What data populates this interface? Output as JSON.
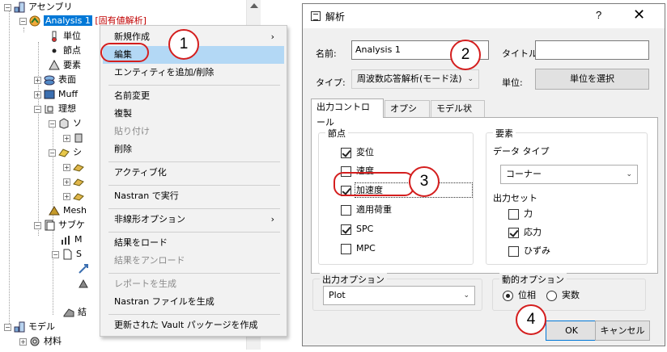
{
  "tree": {
    "items": [
      {
        "label": "アセンブリ",
        "icon": "assembly-icon"
      },
      {
        "label": "Analysis 1",
        "suffix": "[固有値解析]",
        "icon": "analysis-icon"
      },
      {
        "label": "単位",
        "icon": "thermometer-icon"
      },
      {
        "label": "節点",
        "icon": "node-icon"
      },
      {
        "label": "要素",
        "icon": "element-icon"
      },
      {
        "label": "表面",
        "icon": "surface-icon"
      },
      {
        "label": "Muff",
        "icon": "mesh-part-icon"
      },
      {
        "label": "理想",
        "icon": "idealization-icon"
      },
      {
        "label": "ソ",
        "icon": "solid-icon"
      },
      {
        "label": "シ",
        "icon": "shell-icon"
      },
      {
        "label": "Mesh",
        "icon": "mesh-icon"
      },
      {
        "label": "サブケ",
        "icon": "subcase-icon"
      },
      {
        "label": "M",
        "icon": "bar-chart-icon"
      },
      {
        "label": "S",
        "icon": "document-icon"
      },
      {
        "label": "結",
        "icon": "result-icon"
      },
      {
        "label": "モデル",
        "icon": "model-icon"
      },
      {
        "label": "材料",
        "icon": "material-icon"
      }
    ]
  },
  "context_menu": {
    "items": [
      {
        "label": "新規作成",
        "submenu": true
      },
      {
        "label": "編集",
        "highlighted": true
      },
      {
        "label": "エンティティを追加/削除"
      },
      {
        "label": "名前変更"
      },
      {
        "label": "複製"
      },
      {
        "label": "貼り付け",
        "disabled": true
      },
      {
        "label": "削除"
      },
      {
        "label": "アクティブ化"
      },
      {
        "label": "Nastran で実行"
      },
      {
        "label": "非線形オプション",
        "submenu": true
      },
      {
        "label": "結果をロード"
      },
      {
        "label": "結果をアンロード",
        "disabled": true
      },
      {
        "label": "レポートを生成",
        "disabled": true
      },
      {
        "label": "Nastran ファイルを生成"
      },
      {
        "label": "更新された Vault パッケージを作成"
      }
    ],
    "submenu_arrow": "›"
  },
  "dialog": {
    "title": "解析",
    "help": "?",
    "close": "✕",
    "name_label": "名前:",
    "name_value": "Analysis 1",
    "title_label": "タイトル:",
    "title_value": "",
    "type_label": "タイプ:",
    "type_value": "周波数応答解析(モード法)",
    "unit_label": "単位:",
    "unit_button": "単位を選択",
    "tabs": [
      {
        "label": "出力コントロール",
        "active": true
      },
      {
        "label": "オプション"
      },
      {
        "label": "モデル状態"
      }
    ],
    "nodes_group": {
      "title": "節点",
      "items": [
        {
          "label": "変位",
          "checked": true
        },
        {
          "label": "速度",
          "checked": false
        },
        {
          "label": "加速度",
          "checked": true
        },
        {
          "label": "適用荷重",
          "checked": false
        },
        {
          "label": "SPC",
          "checked": true
        },
        {
          "label": "MPC",
          "checked": false
        }
      ]
    },
    "elements_group": {
      "title": "要素",
      "data_type_label": "データ タイプ",
      "data_type_value": "コーナー",
      "output_set_label": "出力セット",
      "items": [
        {
          "label": "力",
          "checked": false
        },
        {
          "label": "応力",
          "checked": true
        },
        {
          "label": "ひずみ",
          "checked": false
        }
      ]
    },
    "output_options": {
      "title": "出力オプション",
      "value": "Plot"
    },
    "dynamic_options": {
      "title": "動的オプション",
      "radios": [
        {
          "label": "位相",
          "selected": true
        },
        {
          "label": "実数",
          "selected": false
        }
      ]
    },
    "ok": "OK",
    "cancel": "キャンセル",
    "dropdown_arrow": "⌄"
  },
  "annotations": {
    "step1": "1",
    "step2": "2",
    "step3": "3",
    "step4": "4"
  },
  "colors": {
    "annotation": "#d41e1e",
    "selection": "#0078d7",
    "menu_highlight": "#b3d8f5"
  }
}
